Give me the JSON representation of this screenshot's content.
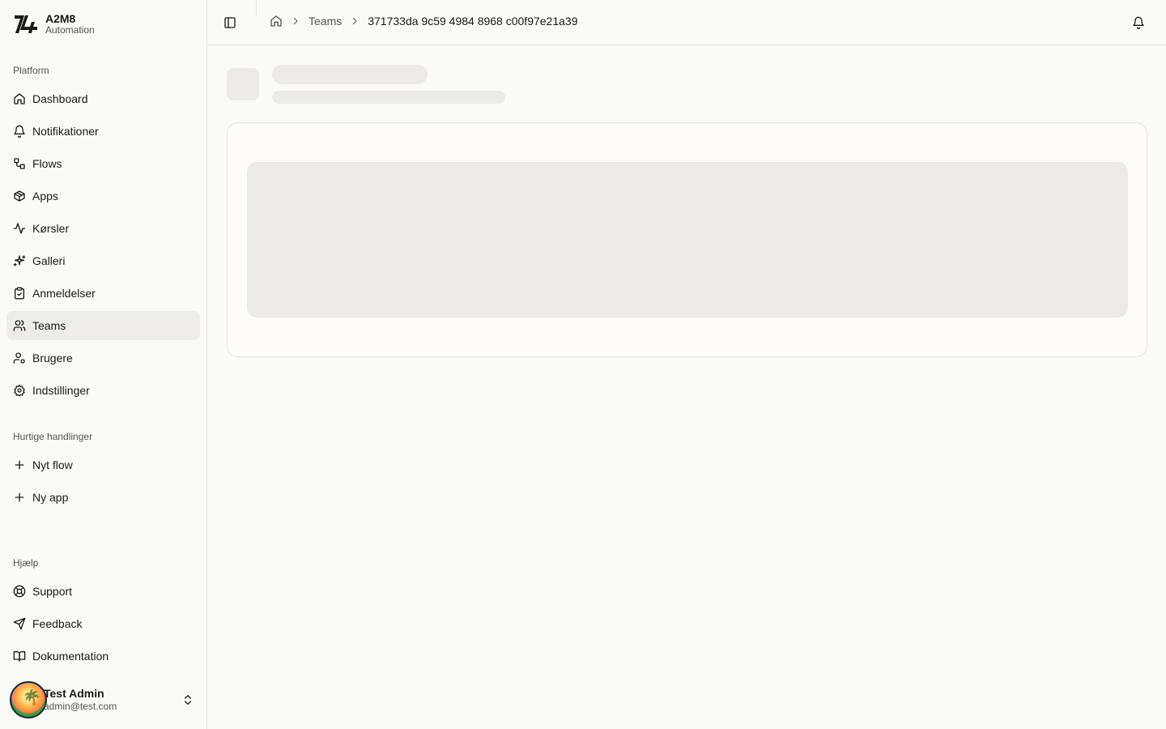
{
  "brand": {
    "name": "A2M8",
    "subtitle": "Automation",
    "logo_icon": "a2m8-logo"
  },
  "sidebar": {
    "groups": [
      {
        "label": "Platform"
      },
      {
        "label": "Hurtige handlinger"
      },
      {
        "label": "Hjælp"
      }
    ],
    "platform_items": [
      {
        "label": "Dashboard",
        "icon": "home-icon"
      },
      {
        "label": "Notifikationer",
        "icon": "bell-icon"
      },
      {
        "label": "Flows",
        "icon": "workflow-icon"
      },
      {
        "label": "Apps",
        "icon": "package-icon"
      },
      {
        "label": "Kørsler",
        "icon": "activity-icon"
      },
      {
        "label": "Galleri",
        "icon": "sparkles-icon"
      },
      {
        "label": "Anmeldelser",
        "icon": "clipboard-check-icon"
      },
      {
        "label": "Teams",
        "icon": "users-icon",
        "active": true
      },
      {
        "label": "Brugere",
        "icon": "user-cog-icon"
      },
      {
        "label": "Indstillinger",
        "icon": "settings-icon"
      }
    ],
    "quick_items": [
      {
        "label": "Nyt flow",
        "icon": "plus-icon"
      },
      {
        "label": "Ny app",
        "icon": "plus-icon"
      }
    ],
    "help_items": [
      {
        "label": "Support",
        "icon": "life-buoy-icon"
      },
      {
        "label": "Feedback",
        "icon": "send-icon"
      },
      {
        "label": "Dokumentation",
        "icon": "book-open-icon"
      }
    ]
  },
  "user": {
    "name": "Test Admin",
    "email": "admin@test.com"
  },
  "topbar": {
    "breadcrumb": {
      "section": "Teams",
      "current": "371733da 9c59 4984 8968 c00f97e21a39"
    }
  },
  "colors": {
    "background": "#fafaf7",
    "active_item": "#efedea",
    "skeleton": "#edebe7",
    "border": "#e7e5e4"
  }
}
